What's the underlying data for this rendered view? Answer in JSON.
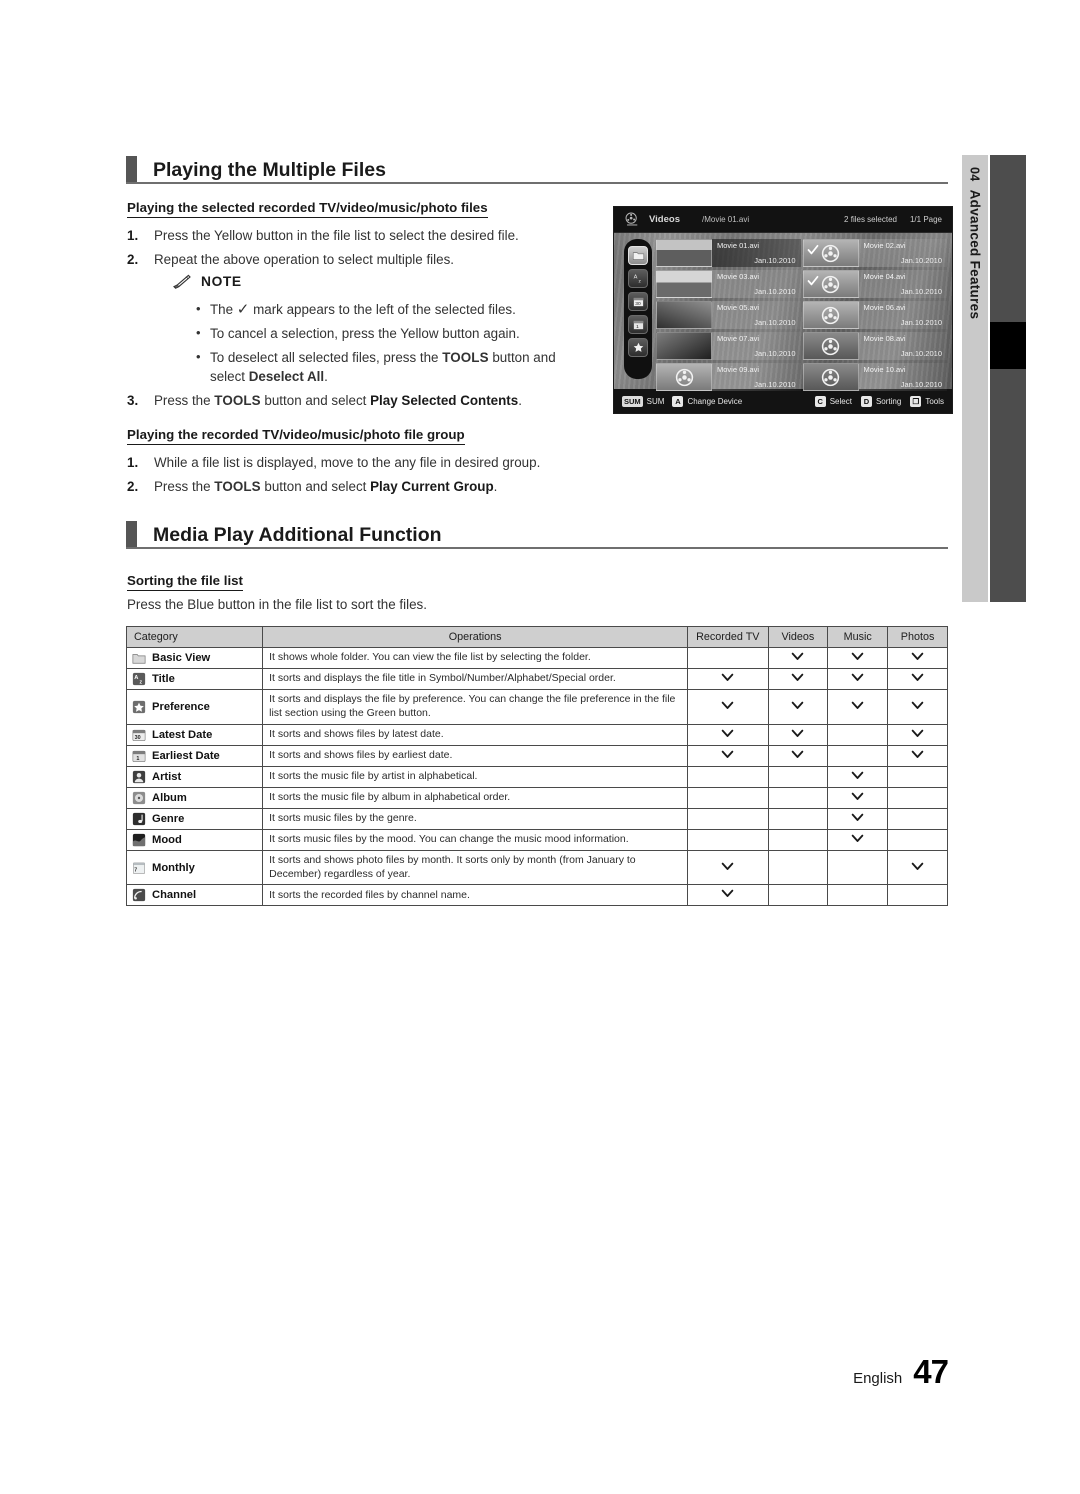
{
  "chapter_tab": {
    "number": "04",
    "label": "Advanced Features"
  },
  "sections": [
    {
      "title": "Playing the Multiple Files"
    },
    {
      "title": "Media Play Additional Function"
    }
  ],
  "subheads": {
    "selected_files": "Playing the selected recorded TV/video/music/photo files",
    "file_group": "Playing the recorded TV/video/music/photo file group",
    "sorting": "Sorting the file list"
  },
  "steps_selected": [
    {
      "num": "1.",
      "text": "Press the Yellow button in the file list to select the desired file."
    },
    {
      "num": "2.",
      "text": "Repeat the above operation to select multiple files."
    }
  ],
  "note": {
    "label": "NOTE",
    "items": [
      {
        "pre": "The ",
        "check": "✓",
        "post": " mark appears to the left of the selected files."
      },
      {
        "pre": "To cancel a selection, press the Yellow button again.",
        "check": "",
        "post": ""
      },
      {
        "pre": "To deselect all selected files, press the ",
        "bold1": "TOOLS",
        "mid": " button and select ",
        "bold2": "Deselect All",
        "end": "."
      }
    ]
  },
  "step3": {
    "num": "3.",
    "pre": "Press the ",
    "bold1": "TOOLS",
    "mid": " button and select ",
    "bold2": "Play Selected Contents",
    "end": "."
  },
  "steps_group": [
    {
      "num": "1.",
      "text": "While a file list is displayed, move to the any file in desired group."
    },
    {
      "num": "2.",
      "pre": "Press the ",
      "bold1": "TOOLS",
      "mid": " button and select ",
      "bold2": "Play Current Group",
      "end": "."
    }
  ],
  "sorting_intro": "Press the Blue button in the file list to sort the files.",
  "tv_screenshot": {
    "app_title": "Videos",
    "path": "/Movie 01.avi",
    "selected_count": "2 files selected",
    "page": "1/1 Page",
    "rail_icons": [
      "folder-icon",
      "title-sort-icon",
      "latest-date-icon",
      "earliest-date-icon",
      "preference-icon"
    ],
    "files": [
      {
        "name": "Movie 01.avi",
        "date": "Jan.10.2010",
        "checked": false,
        "highlighted": true,
        "thumb": "photo1"
      },
      {
        "name": "Movie 02.avi",
        "date": "Jan.10.2010",
        "checked": true,
        "highlighted": false,
        "thumb": "icon"
      },
      {
        "name": "Movie 03.avi",
        "date": "Jan.10.2010",
        "checked": false,
        "highlighted": false,
        "thumb": "photo2"
      },
      {
        "name": "Movie 04.avi",
        "date": "Jan.10.2010",
        "checked": true,
        "highlighted": false,
        "thumb": "icon"
      },
      {
        "name": "Movie 05.avi",
        "date": "Jan.10.2010",
        "checked": false,
        "highlighted": false,
        "thumb": "photo3"
      },
      {
        "name": "Movie 06.avi",
        "date": "Jan.10.2010",
        "checked": false,
        "highlighted": false,
        "thumb": "icon"
      },
      {
        "name": "Movie 07.avi",
        "date": "Jan.10.2010",
        "checked": false,
        "highlighted": false,
        "thumb": "photo4"
      },
      {
        "name": "Movie 08.avi",
        "date": "Jan.10.2010",
        "checked": false,
        "highlighted": false,
        "thumb": "icon dk"
      },
      {
        "name": "Movie 09.avi",
        "date": "Jan.10.2010",
        "checked": false,
        "highlighted": false,
        "thumb": "icon"
      },
      {
        "name": "Movie 10.avi",
        "date": "Jan.10.2010",
        "checked": false,
        "highlighted": false,
        "thumb": "icon dk"
      }
    ],
    "bottom_left": [
      {
        "key": "SUM",
        "key_style": "wide",
        "label": "SUM"
      },
      {
        "key": "A",
        "key_style": "",
        "label": "Change Device"
      }
    ],
    "bottom_right": [
      {
        "key": "C",
        "label": "Select"
      },
      {
        "key": "D",
        "label": "Sorting"
      },
      {
        "key": "❐",
        "label": "Tools"
      }
    ]
  },
  "sort_table": {
    "headers": [
      "Category",
      "Operations",
      "Recorded TV",
      "Videos",
      "Music",
      "Photos"
    ],
    "rows": [
      {
        "icon": "folder-icon",
        "category": "Basic View",
        "operations": "It shows whole folder. You can view the file list by selecting the folder.",
        "marks": [
          false,
          true,
          true,
          true
        ]
      },
      {
        "icon": "title-sort-icon",
        "category": "Title",
        "operations": "It sorts and displays the file title in Symbol/Number/Alphabet/Special order.",
        "marks": [
          true,
          true,
          true,
          true
        ]
      },
      {
        "icon": "preference-icon",
        "category": "Preference",
        "operations": "It sorts and displays the file by preference. You can change the file preference in the file list section using the Green button.",
        "marks": [
          true,
          true,
          true,
          true
        ]
      },
      {
        "icon": "latest-date-icon",
        "category": "Latest Date",
        "operations": "It sorts and shows files by latest date.",
        "marks": [
          true,
          true,
          false,
          true
        ]
      },
      {
        "icon": "earliest-date-icon",
        "category": "Earliest Date",
        "operations": "It sorts and shows files by earliest date.",
        "marks": [
          true,
          true,
          false,
          true
        ]
      },
      {
        "icon": "artist-icon",
        "category": "Artist",
        "operations": "It sorts the music file by artist in alphabetical.",
        "marks": [
          false,
          false,
          true,
          false
        ]
      },
      {
        "icon": "album-icon",
        "category": "Album",
        "operations": "It sorts the music file by album in alphabetical order.",
        "marks": [
          false,
          false,
          true,
          false
        ]
      },
      {
        "icon": "genre-icon",
        "category": "Genre",
        "operations": "It sorts music files by the genre.",
        "marks": [
          false,
          false,
          true,
          false
        ]
      },
      {
        "icon": "mood-icon",
        "category": "Mood",
        "operations": "It sorts music files by the mood. You can change the music mood information.",
        "marks": [
          false,
          false,
          true,
          false
        ]
      },
      {
        "icon": "monthly-icon",
        "category": "Monthly",
        "operations": "It sorts and shows photo files by month. It sorts only by month (from January to December) regardless of year.",
        "marks": [
          true,
          false,
          false,
          true
        ]
      },
      {
        "icon": "channel-icon",
        "category": "Channel",
        "operations": "It sorts the recorded files by channel name.",
        "marks": [
          true,
          false,
          false,
          false
        ]
      }
    ]
  },
  "footer": {
    "language": "English",
    "page_number": "47"
  },
  "colors": {
    "accent_gray": "#555555",
    "tab_gray": "#c9c9c9",
    "bar_gray": "#4d4d4d",
    "header_row": "#cfcfcf"
  }
}
